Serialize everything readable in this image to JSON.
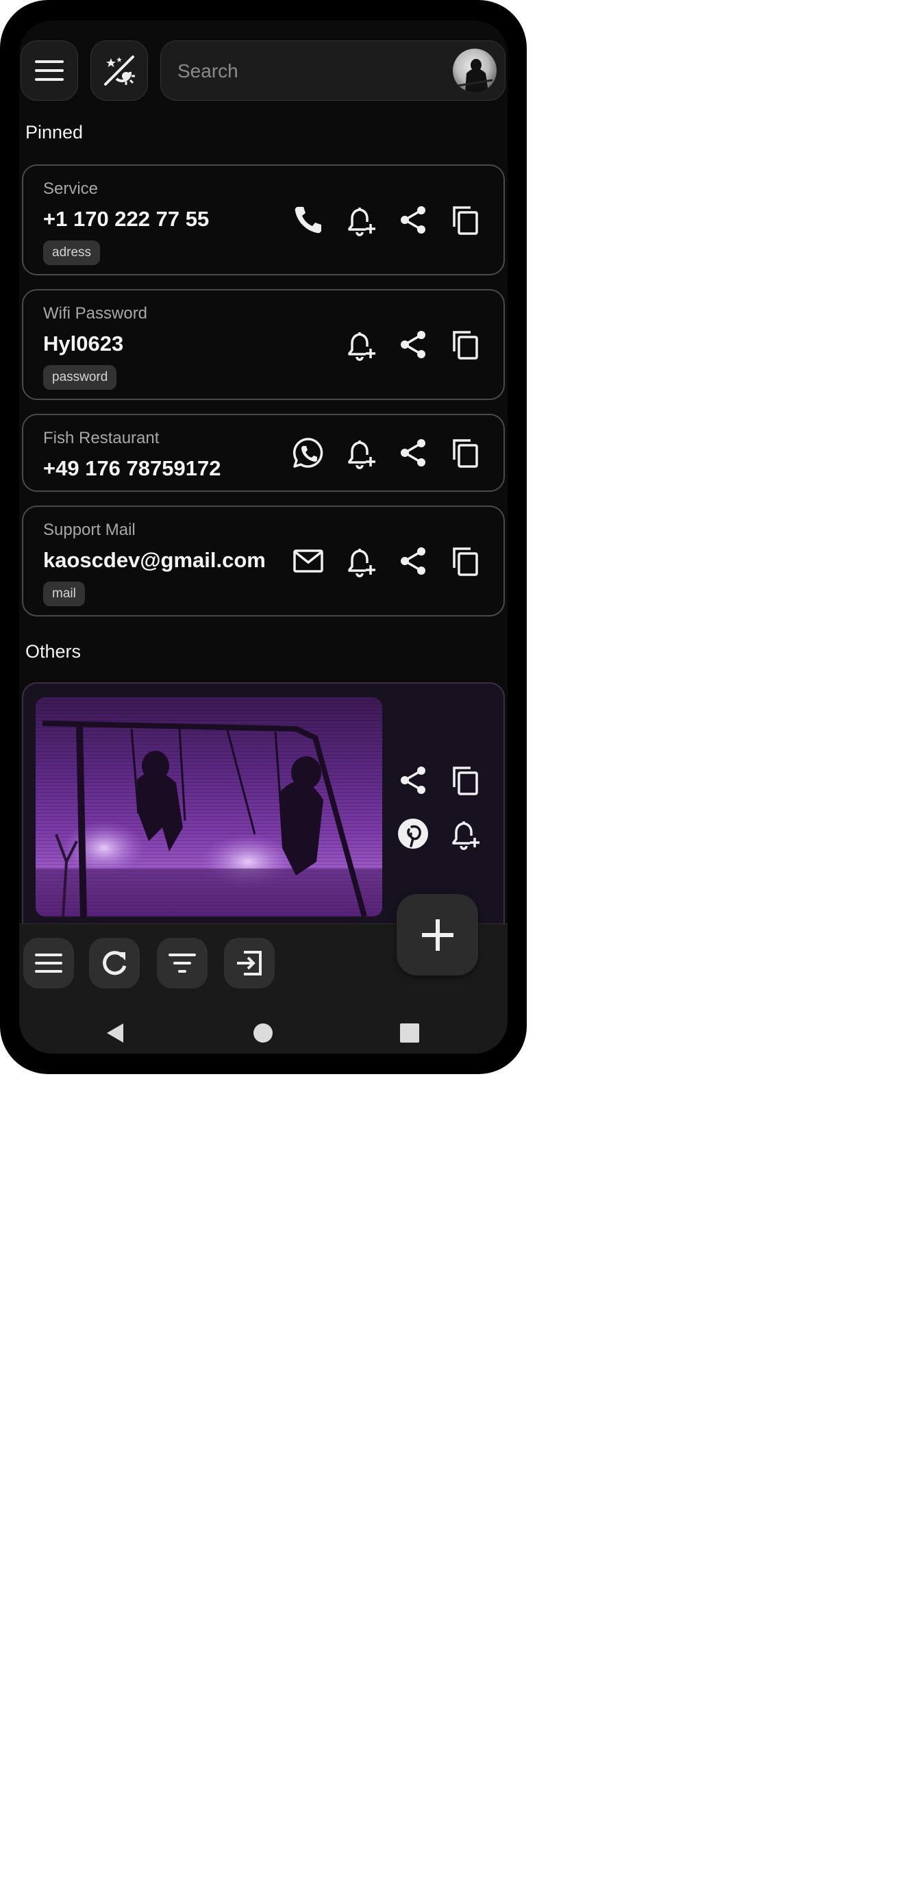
{
  "header": {
    "menu_icon": "menu-icon",
    "theme_icon": "theme-toggle-icon",
    "search_placeholder": "Search",
    "avatar": "user-avatar"
  },
  "sections": {
    "pinned_title": "Pinned",
    "others_title": "Others"
  },
  "pinned": [
    {
      "label": "Service",
      "value": "+1 170 222 77 55",
      "tag": "adress",
      "primary_action": "phone-icon"
    },
    {
      "label": "Wifi Password",
      "value": "Hyl0623",
      "tag": "password",
      "primary_action": ""
    },
    {
      "label": "Fish Restaurant",
      "value": "+49 176 78759172",
      "tag": "",
      "primary_action": "whatsapp-icon"
    },
    {
      "label": "Support Mail",
      "value": "kaoscdev@gmail.com",
      "tag": "mail",
      "primary_action": "mail-icon"
    }
  ],
  "others": [
    {
      "type": "image",
      "actions": [
        "share-icon",
        "copy-icon",
        "pinterest-icon",
        "add-reminder-icon"
      ]
    }
  ],
  "bottom_bar": {
    "buttons": [
      "menu-icon",
      "refresh-icon",
      "filter-icon",
      "import-icon"
    ],
    "fab": "add-icon"
  },
  "system_nav": [
    "back-icon",
    "home-icon",
    "recents-icon"
  ],
  "colors": {
    "background": "#0b0b0b",
    "card_border": "#4a4a4a",
    "chip_bg": "#333333",
    "text_primary": "#f4f4f4",
    "text_secondary": "#a8a8a8"
  }
}
